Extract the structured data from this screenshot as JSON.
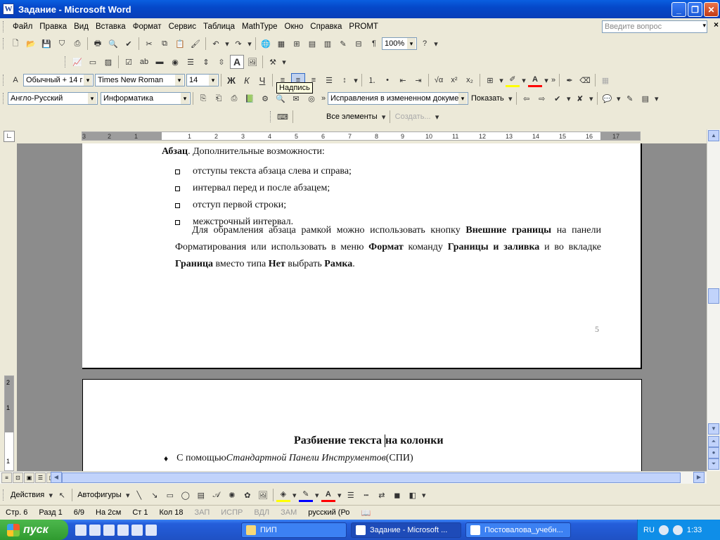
{
  "window": {
    "title": "Задание - Microsoft Word",
    "app_icon": "W"
  },
  "menu": {
    "items": [
      "Файл",
      "Правка",
      "Вид",
      "Вставка",
      "Формат",
      "Сервис",
      "Таблица",
      "MathType",
      "Окно",
      "Справка",
      "PROMT"
    ],
    "help_placeholder": "Введите вопрос"
  },
  "toolbar_standard": {
    "zoom": "100%"
  },
  "toolbar_format": {
    "style": "Обычный + 14 г",
    "font": "Times New Roman",
    "size": "14",
    "bold": "Ж",
    "italic": "К",
    "underline": "Ч"
  },
  "toolbar_promt": {
    "direction": "Англо-Русский",
    "subject": "Информатика"
  },
  "toolbar_review": {
    "display": "Исправления в измененном документ",
    "show": "Показать"
  },
  "toolbar_styles": {
    "all_elements": "Все элементы",
    "create": "Создать..."
  },
  "tooltip": "Надпись",
  "ruler": {
    "numbers": [
      "3",
      "2",
      "1",
      "1",
      "2",
      "3",
      "4",
      "5",
      "6",
      "7",
      "8",
      "9",
      "10",
      "11",
      "12",
      "13",
      "14",
      "15",
      "16",
      "17"
    ]
  },
  "vertical_ruler": {
    "numbers": [
      "2",
      "1",
      "1"
    ]
  },
  "document": {
    "page1": {
      "para_start_bold": "Абзац",
      "para_start_rest": ". Дополнительные возможности:",
      "bullets": [
        "отступы текста абзаца слева и справа;",
        "интервал перед и после абзацем;",
        "отступ первой строки;",
        "межстрочный интервал."
      ],
      "p2_t1": "Для обрамления абзаца рамкой можно использовать кнопку ",
      "p2_b1": "Внешние границы",
      "p2_t2": " на панели Форматирования  или использовать в меню ",
      "p2_b2": "Формат",
      "p2_t3": " команду ",
      "p2_b3": "Границы и заливка",
      "p2_t4": " и во вкладке ",
      "p2_b4": "Граница",
      "p2_t5": " вместо типа ",
      "p2_b5": "Нет",
      "p2_t6": " выбрать ",
      "p2_b6": "Рамка",
      "p2_end": ".",
      "page_number": "5"
    },
    "page2": {
      "heading_part1": "Разбиение текста ",
      "heading_part2": "на колонки",
      "item_text1": "С помощью ",
      "item_italic": "Стандартной Панели Инструментов",
      "item_text2": " (СПИ)"
    }
  },
  "drawing_toolbar": {
    "actions": "Действия",
    "autoshapes": "Автофигуры"
  },
  "statusbar": {
    "page": "Стр.   6",
    "section": "Разд   1",
    "pages": "6/9",
    "at": "На  2см",
    "line": "Ст   1",
    "col": "Кол  18",
    "rec": "ЗАП",
    "trk": "ИСПР",
    "ext": "ВДЛ",
    "ovr": "ЗАМ",
    "lang": "русский (Ро"
  },
  "taskbar": {
    "start": "пуск",
    "tasks": [
      "ПИП",
      "Задание - Microsoft ...",
      "Постовалова_учебн..."
    ],
    "lang": "RU",
    "clock": "1:33"
  }
}
